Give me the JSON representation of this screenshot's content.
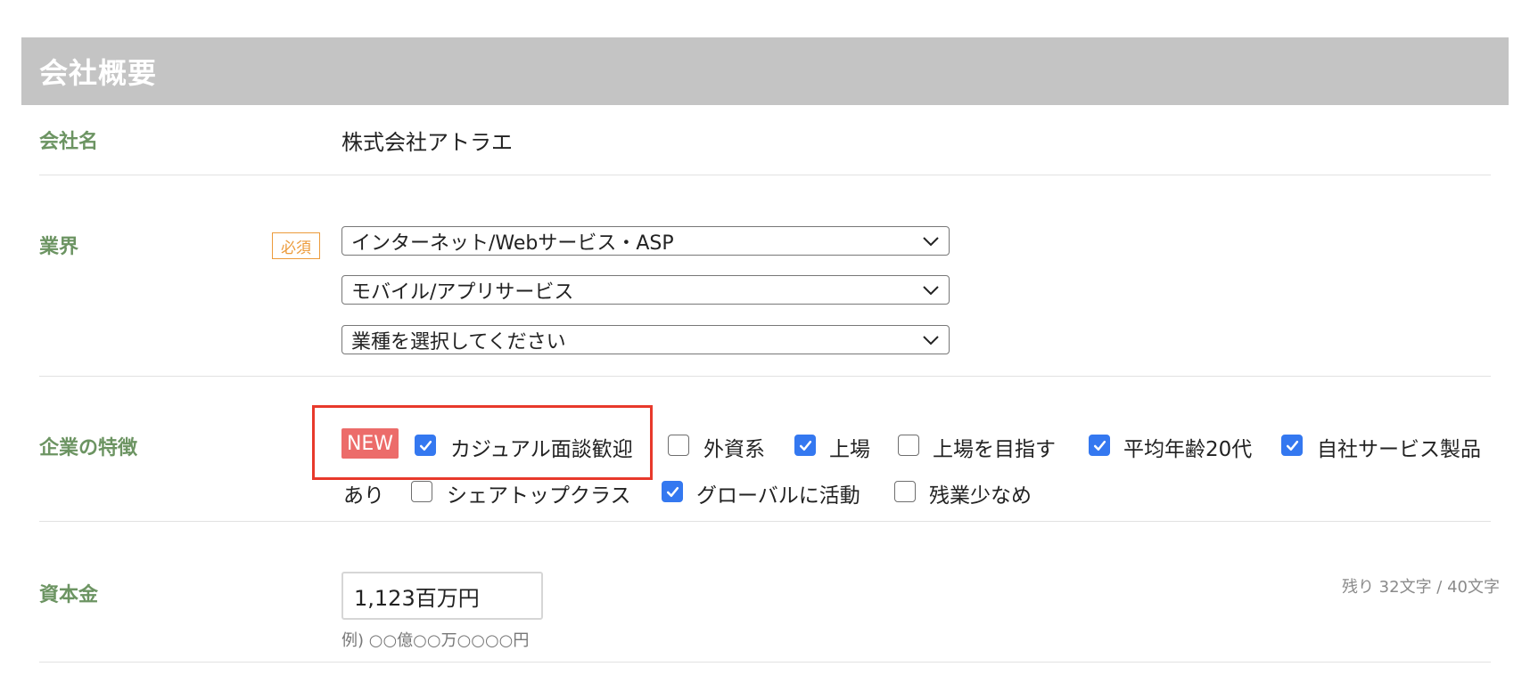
{
  "section": {
    "title": "会社概要"
  },
  "company": {
    "label": "会社名",
    "value": "株式会社アトラエ"
  },
  "industry": {
    "label": "業界",
    "required_badge": "必須",
    "selects": [
      "インターネット/Webサービス・ASP",
      "モバイル/アプリサービス",
      "業種を選択してください"
    ]
  },
  "features": {
    "label": "企業の特徴",
    "new_badge": "NEW",
    "options": [
      {
        "label": "カジュアル面談歓迎",
        "checked": true
      },
      {
        "label": "外資系",
        "checked": false
      },
      {
        "label": "上場",
        "checked": true
      },
      {
        "label": "上場を目指す",
        "checked": false
      },
      {
        "label": "平均年齢20代",
        "checked": true
      },
      {
        "label": "自社サービス製品",
        "checked": true
      },
      {
        "label": "あり",
        "checked": null
      },
      {
        "label": "シェアトップクラス",
        "checked": false
      },
      {
        "label": "グローバルに活動",
        "checked": true
      },
      {
        "label": "残業少なめ",
        "checked": false
      }
    ]
  },
  "capital": {
    "label": "資本金",
    "value": "1,123百万円",
    "hint": "例) ○○億○○万○○○○円",
    "counter": "残り 32文字 / 40文字"
  },
  "colors": {
    "header_bg": "#c4c4c4",
    "label_green": "#6c9462",
    "checkbox_blue": "#3478f0",
    "new_badge_bg": "#ec6c6a",
    "required_orange": "#ec9b3b",
    "highlight_red": "#e8392b"
  }
}
